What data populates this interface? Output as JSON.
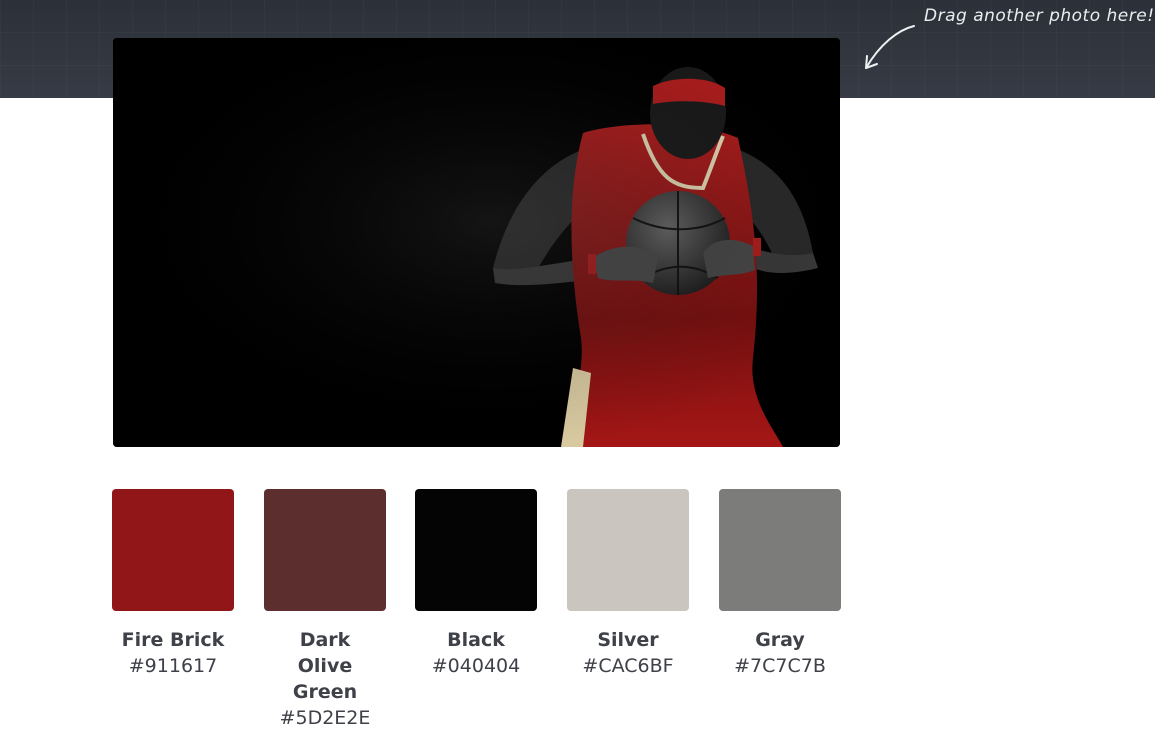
{
  "header": {
    "drag_hint": "Drag another photo here!"
  },
  "photo": {
    "subject": "basketball player in red jersey holding ball against black background",
    "background_color": "#000000"
  },
  "palette": [
    {
      "name": "Fire Brick",
      "hex": "#911617"
    },
    {
      "name": "Dark Olive Green",
      "hex": "#5D2E2E"
    },
    {
      "name": "Black",
      "hex": "#040404"
    },
    {
      "name": "Silver",
      "hex": "#CAC6BF"
    },
    {
      "name": "Gray",
      "hex": "#7C7C7B"
    }
  ]
}
